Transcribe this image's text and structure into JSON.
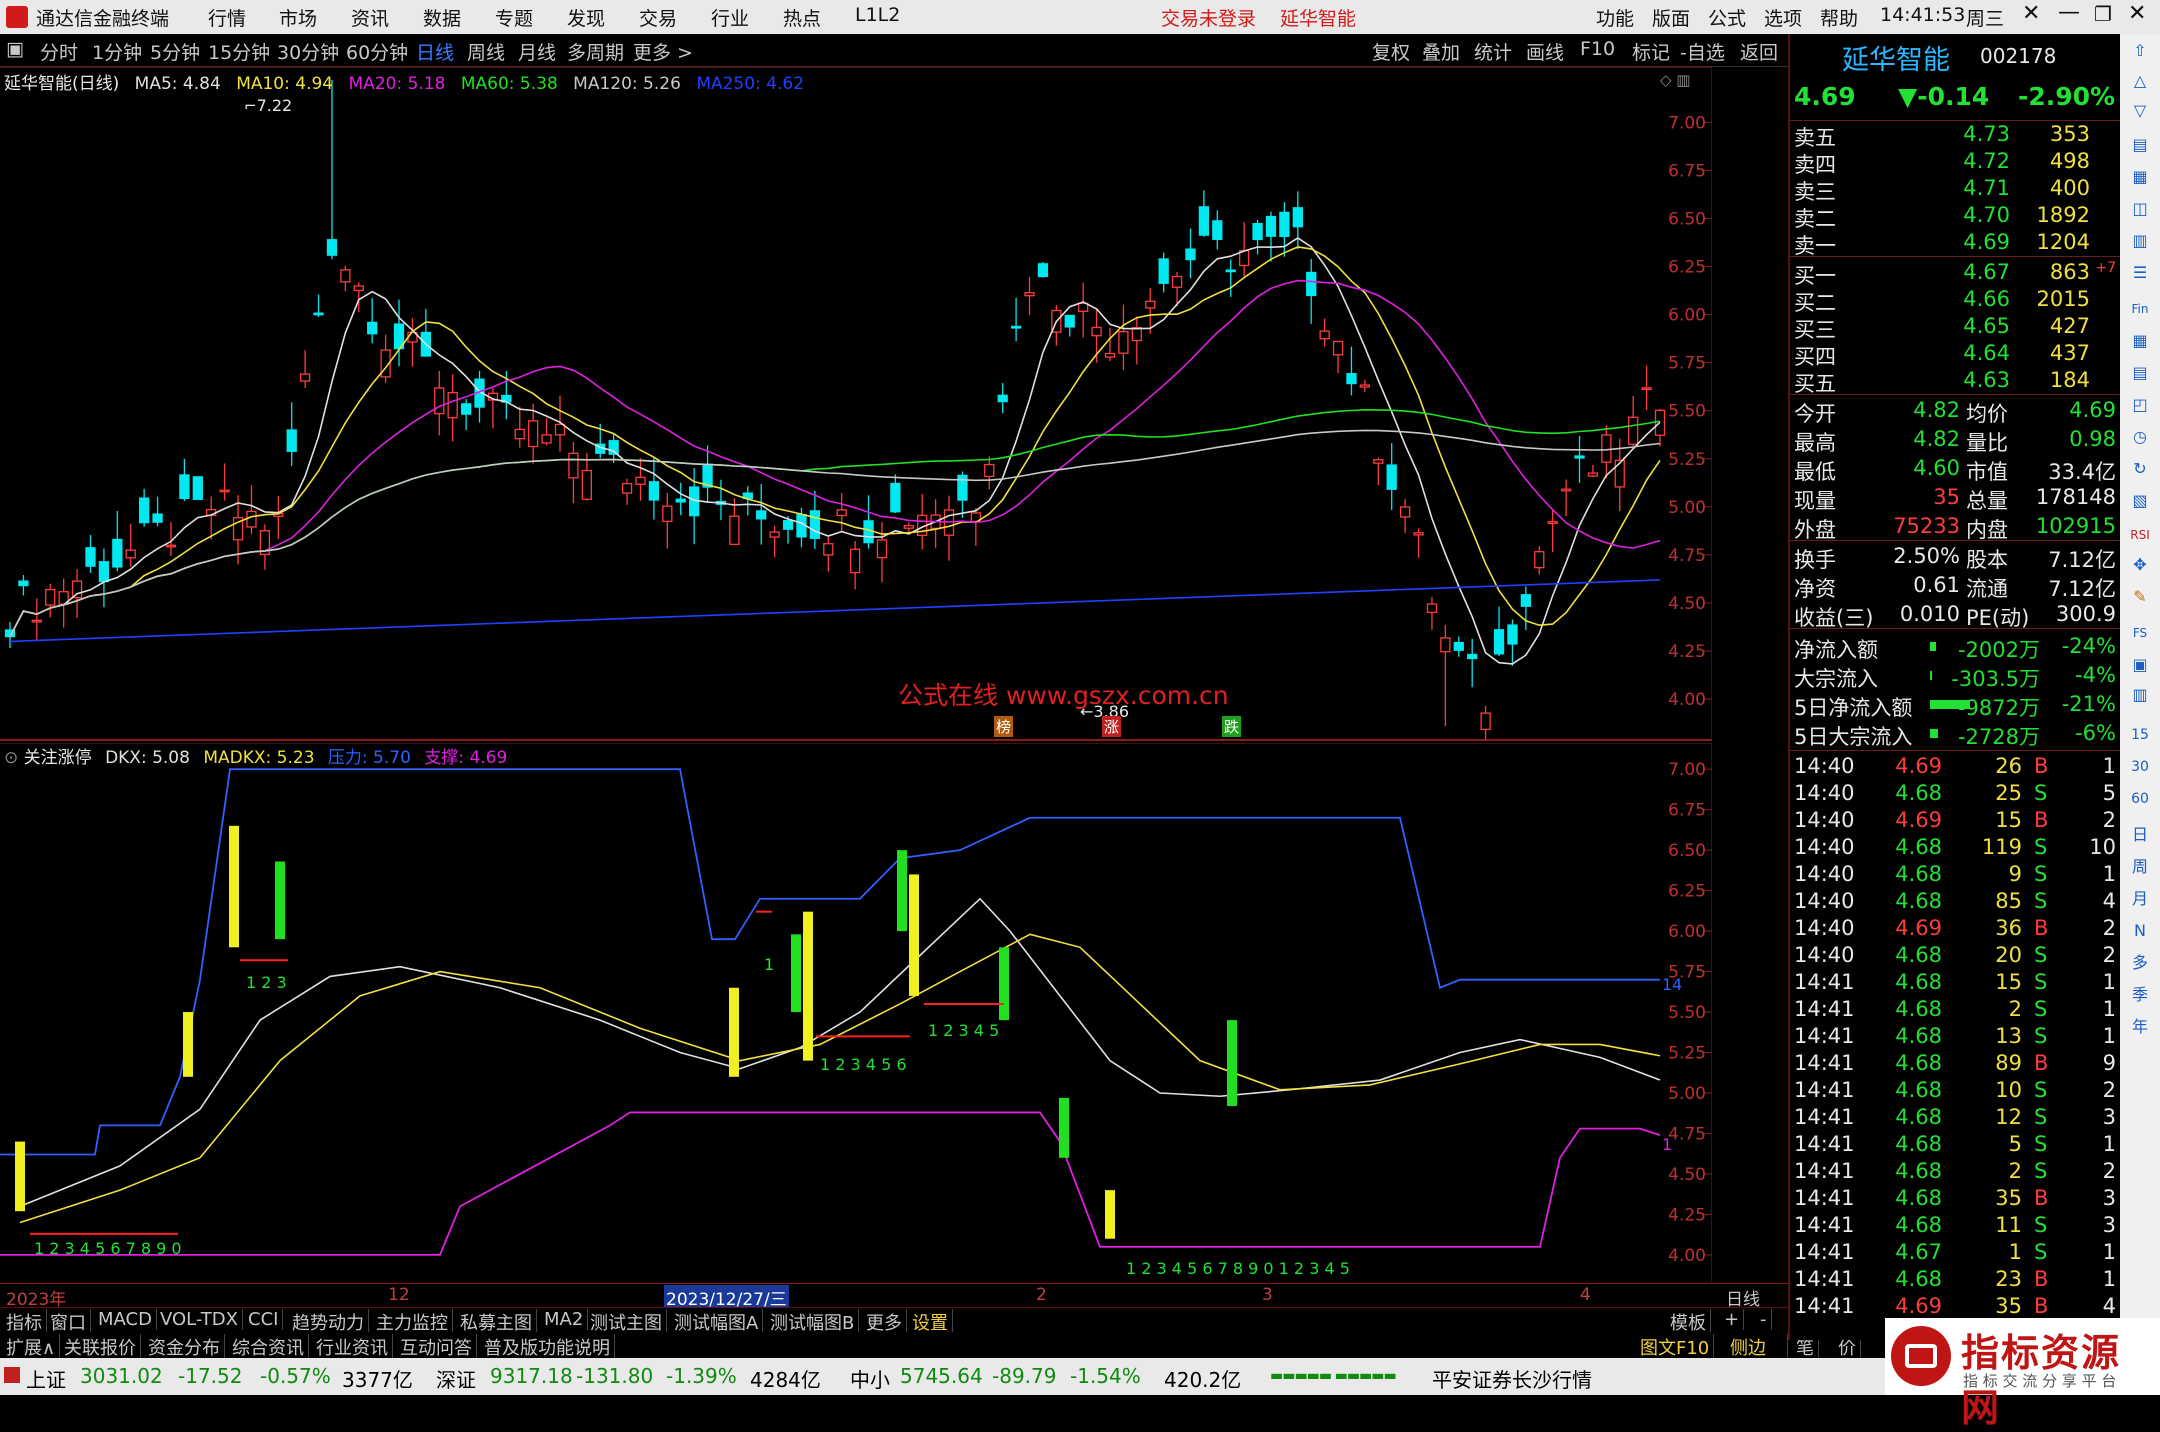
{
  "titlebar": {
    "app_name": "通达信金融终端",
    "menu": [
      "行情",
      "市场",
      "资讯",
      "数据",
      "专题",
      "发现",
      "交易",
      "行业",
      "热点",
      "L1L2"
    ],
    "login_status": "交易未登录",
    "stock_name": "延华智能",
    "right_menu": [
      "功能",
      "版面",
      "公式",
      "选项",
      "帮助"
    ],
    "time": "14:41:53",
    "weekday": "周三"
  },
  "periodbar": {
    "periods": [
      "分时",
      "1分钟",
      "5分钟",
      "15分钟",
      "30分钟",
      "60分钟",
      "日线",
      "周线",
      "月线",
      "多周期",
      "更多 >"
    ],
    "active": "日线",
    "right_buttons": [
      "复权",
      "叠加",
      "统计",
      "画线",
      "F10",
      "标记",
      "-自选",
      "返回"
    ]
  },
  "main_chart": {
    "legend": {
      "title": "延华智能(日线)",
      "items": [
        {
          "label": "MA5: 4.84",
          "color": "#e0e0e0"
        },
        {
          "label": "MA10: 4.94",
          "color": "#f0e040"
        },
        {
          "label": "MA20: 5.18",
          "color": "#e020e0"
        },
        {
          "label": "MA60: 5.38",
          "color": "#20e020"
        },
        {
          "label": "MA120: 5.26",
          "color": "#c8c8c8"
        },
        {
          "label": "MA250: 4.62",
          "color": "#2040ff"
        }
      ]
    },
    "high_label": "7.22",
    "low_label": "3.86",
    "watermark": "公式在线  www.gszx.com.cn",
    "markers": [
      "榜",
      "涨",
      "跌"
    ],
    "y_ticks": [
      "7.00",
      "6.75",
      "6.50",
      "6.25",
      "6.00",
      "5.75",
      "5.50",
      "5.25",
      "5.00",
      "4.75",
      "4.50",
      "4.25",
      "4.00"
    ]
  },
  "sub_chart": {
    "legend": {
      "title": "关注涨停",
      "items": [
        {
          "label": "DKX: 5.08",
          "color": "#e0e0e0"
        },
        {
          "label": "MADKX: 5.23",
          "color": "#f0e040"
        },
        {
          "label": "压力: 5.70",
          "color": "#3060ff"
        },
        {
          "label": "支撑: 4.69",
          "color": "#e020e0"
        }
      ]
    },
    "y_ticks": [
      "7.00",
      "6.75",
      "6.50",
      "6.25",
      "6.00",
      "5.75",
      "5.50",
      "5.25",
      "5.00",
      "4.75",
      "4.50",
      "4.25",
      "4.00"
    ],
    "counters": [
      "1 2 3",
      "1",
      "1 2 3 4 5 6",
      "1 2 3 4 5",
      "1 2 3 4 5 6 7 8 9 0",
      "1 2 3 4 5 6 7 8 9 0 1 2 3 4 5"
    ],
    "right_labels": [
      "14",
      "1"
    ]
  },
  "x_axis": {
    "labels": [
      "2023年",
      "12",
      "2023/12/27/三",
      "2",
      "3",
      "4"
    ],
    "right_label": "日线"
  },
  "chart_data": {
    "type": "candlestick",
    "title": "延华智能(日线)",
    "ylim": [
      4.0,
      7.2
    ],
    "ma_values": {
      "MA5": 4.84,
      "MA10": 4.94,
      "MA20": 5.18,
      "MA60": 5.38,
      "MA120": 5.26,
      "MA250": 4.62
    },
    "high": 7.22,
    "low": 3.86,
    "indicator": {
      "name": "关注涨停",
      "DKX": 5.08,
      "MADKX": 5.23,
      "压力": 5.7,
      "支撑": 4.69
    }
  },
  "quote": {
    "stock_name": "延华智能",
    "stock_code": "002178",
    "price": "4.69",
    "change": "▼-0.14",
    "change_pct": "-2.90%",
    "asks": [
      {
        "label": "卖五",
        "price": "4.73",
        "vol": "353"
      },
      {
        "label": "卖四",
        "price": "4.72",
        "vol": "498"
      },
      {
        "label": "卖三",
        "price": "4.71",
        "vol": "400"
      },
      {
        "label": "卖二",
        "price": "4.70",
        "vol": "1892"
      },
      {
        "label": "卖一",
        "price": "4.69",
        "vol": "1204"
      }
    ],
    "bids": [
      {
        "label": "买一",
        "price": "4.67",
        "vol": "863",
        "extra": "+7"
      },
      {
        "label": "买二",
        "price": "4.66",
        "vol": "2015",
        "extra": ""
      },
      {
        "label": "买三",
        "price": "4.65",
        "vol": "427",
        "extra": ""
      },
      {
        "label": "买四",
        "price": "4.64",
        "vol": "437",
        "extra": ""
      },
      {
        "label": "买五",
        "price": "4.63",
        "vol": "184",
        "extra": ""
      }
    ],
    "stats": [
      {
        "l1": "今开",
        "v1": "4.82",
        "l2": "均价",
        "v2": "4.69"
      },
      {
        "l1": "最高",
        "v1": "4.82",
        "l2": "量比",
        "v2": "0.98"
      },
      {
        "l1": "最低",
        "v1": "4.60",
        "l2": "市值",
        "v2": "33.4亿"
      },
      {
        "l1": "现量",
        "v1": "35",
        "l2": "总量",
        "v2": "178148"
      },
      {
        "l1": "外盘",
        "v1": "75233",
        "l2": "内盘",
        "v2": "102915"
      }
    ],
    "stats2": [
      {
        "l1": "换手",
        "v1": "2.50%",
        "l2": "股本",
        "v2": "7.12亿"
      },
      {
        "l1": "净资",
        "v1": "0.61",
        "l2": "流通",
        "v2": "7.12亿"
      },
      {
        "l1": "收益(三)",
        "v1": "0.010",
        "l2": "PE(动)",
        "v2": "300.9"
      }
    ],
    "flows": [
      {
        "label": "净流入额",
        "value": "-2002万",
        "pct": "-24%"
      },
      {
        "label": "大宗流入",
        "value": "-303.5万",
        "pct": "-4%"
      },
      {
        "label": "5日净流入额",
        "value": "-9872万",
        "pct": "-21%"
      },
      {
        "label": "5日大宗流入",
        "value": "-2728万",
        "pct": "-6%"
      }
    ],
    "ticks": [
      {
        "t": "14:40",
        "p": "4.69",
        "v": "26",
        "d": "B",
        "n": "1"
      },
      {
        "t": "14:40",
        "p": "4.68",
        "v": "25",
        "d": "S",
        "n": "5"
      },
      {
        "t": "14:40",
        "p": "4.69",
        "v": "15",
        "d": "B",
        "n": "2"
      },
      {
        "t": "14:40",
        "p": "4.68",
        "v": "119",
        "d": "S",
        "n": "10"
      },
      {
        "t": "14:40",
        "p": "4.68",
        "v": "9",
        "d": "S",
        "n": "1"
      },
      {
        "t": "14:40",
        "p": "4.68",
        "v": "85",
        "d": "S",
        "n": "4"
      },
      {
        "t": "14:40",
        "p": "4.69",
        "v": "36",
        "d": "B",
        "n": "2"
      },
      {
        "t": "14:40",
        "p": "4.68",
        "v": "20",
        "d": "S",
        "n": "2"
      },
      {
        "t": "14:41",
        "p": "4.68",
        "v": "15",
        "d": "S",
        "n": "1"
      },
      {
        "t": "14:41",
        "p": "4.68",
        "v": "2",
        "d": "S",
        "n": "1"
      },
      {
        "t": "14:41",
        "p": "4.68",
        "v": "13",
        "d": "S",
        "n": "1"
      },
      {
        "t": "14:41",
        "p": "4.68",
        "v": "89",
        "d": "B",
        "n": "9"
      },
      {
        "t": "14:41",
        "p": "4.68",
        "v": "10",
        "d": "S",
        "n": "2"
      },
      {
        "t": "14:41",
        "p": "4.68",
        "v": "12",
        "d": "S",
        "n": "3"
      },
      {
        "t": "14:41",
        "p": "4.68",
        "v": "5",
        "d": "S",
        "n": "1"
      },
      {
        "t": "14:41",
        "p": "4.68",
        "v": "2",
        "d": "S",
        "n": "2"
      },
      {
        "t": "14:41",
        "p": "4.68",
        "v": "35",
        "d": "B",
        "n": "3"
      },
      {
        "t": "14:41",
        "p": "4.68",
        "v": "11",
        "d": "S",
        "n": "3"
      },
      {
        "t": "14:41",
        "p": "4.67",
        "v": "1",
        "d": "S",
        "n": "1"
      },
      {
        "t": "14:41",
        "p": "4.68",
        "v": "23",
        "d": "B",
        "n": "1"
      },
      {
        "t": "14:41",
        "p": "4.69",
        "v": "35",
        "d": "B",
        "n": "4"
      }
    ]
  },
  "iconstrip": [
    "日",
    "周",
    "月",
    "N",
    "多",
    "季",
    "年"
  ],
  "iconstrip_extra": [
    "15",
    "30",
    "60",
    "RSI",
    "FS"
  ],
  "tabs1": [
    "指标",
    "窗口",
    "MACD",
    "VOL-TDX",
    "CCI",
    "趋势动力",
    "主力监控",
    "私募主图",
    "MA2",
    "测试主图",
    "测试幅图A",
    "测试幅图B",
    "更多",
    "设置"
  ],
  "tabs1_right": [
    "模板",
    "+",
    "-"
  ],
  "tabs2": [
    "扩展∧",
    "关联报价",
    "资金分布",
    "综合资讯",
    "行业资讯",
    "互动问答",
    "普及版功能说明"
  ],
  "tabs2_right": [
    "图文F10",
    "侧边栏 ≪",
    "笔",
    "价"
  ],
  "status": {
    "sh_name": "上证",
    "sh_val": "3031.02",
    "sh_chg": "-17.52",
    "sh_pct": "-0.57%",
    "sh_amt": "3377亿",
    "sz_name": "深证",
    "sz_val": "9317.18",
    "sz_chg": "-131.80",
    "sz_pct": "-1.39%",
    "sz_amt": "4284亿",
    "zx_name": "中小",
    "zx_val": "5745.64",
    "zx_chg": "-89.79",
    "zx_pct": "-1.54%",
    "zx_amt": "420.2亿",
    "broker": "平安证券长沙行情"
  },
  "logo": {
    "title": "指标资源网",
    "subtitle": "指 标 交 流 分 享 平 台"
  },
  "colors": {
    "up": "#ff3c3c",
    "down": "#22e034",
    "axis": "#8b1a1a",
    "blue_line": "#3060ff"
  }
}
